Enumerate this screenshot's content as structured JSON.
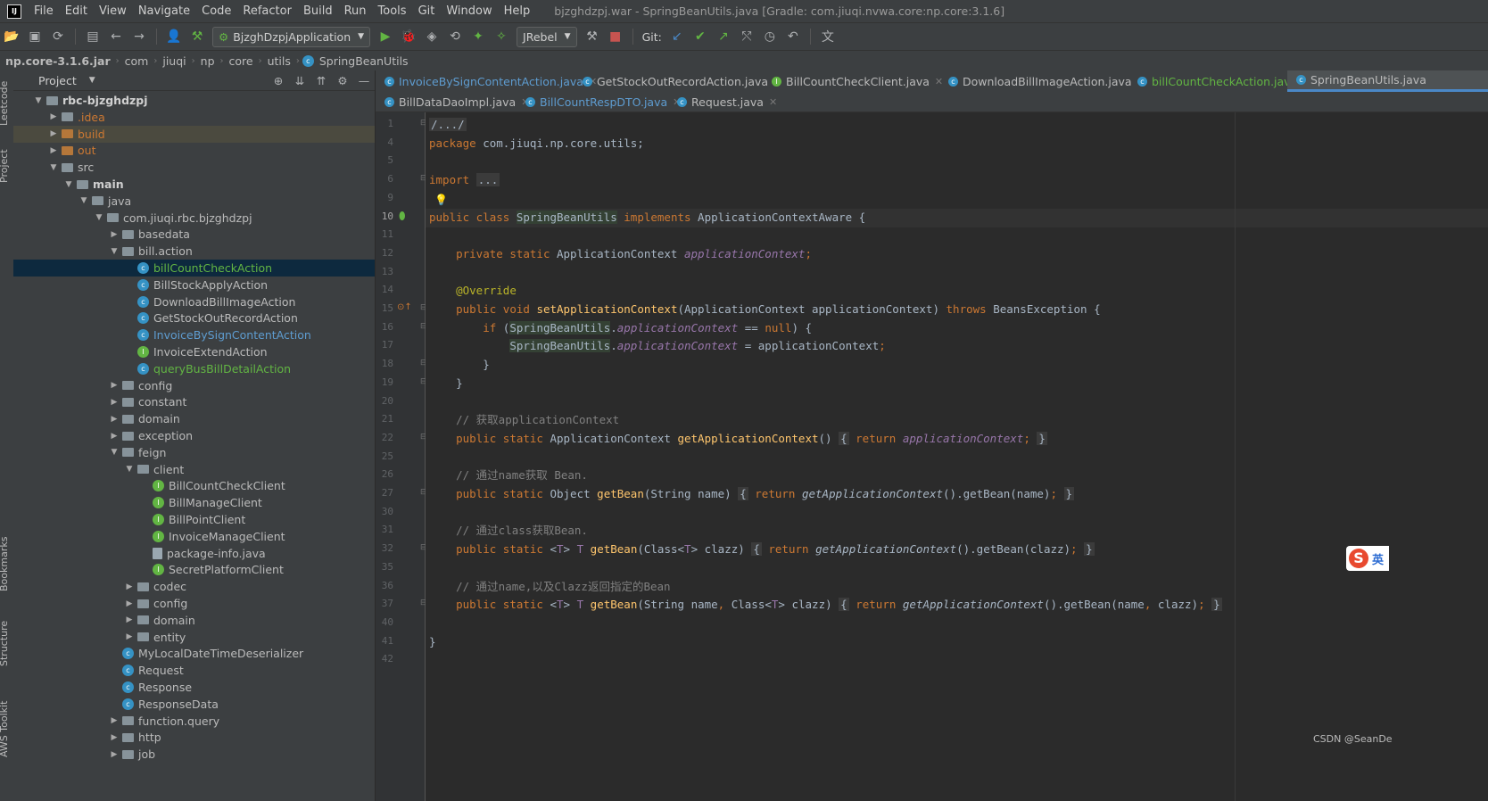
{
  "menu": {
    "logo": "IJ",
    "items": [
      "File",
      "Edit",
      "View",
      "Navigate",
      "Code",
      "Refactor",
      "Build",
      "Run",
      "Tools",
      "Git",
      "Window",
      "Help"
    ],
    "window_title": "bjzghdzpj.war - SpringBeanUtils.java [Gradle: com.jiuqi.nvwa.core:np.core:3.1.6]"
  },
  "toolbar": {
    "run_config": "BjzghDzpjApplication",
    "jrebel": "JRebel",
    "git_label": "Git:"
  },
  "navbar": {
    "crumbs": [
      "np.core-3.1.6.jar",
      "com",
      "jiuqi",
      "np",
      "core",
      "utils",
      "SpringBeanUtils"
    ]
  },
  "stripe": {
    "leetcode": "Leetcode",
    "project": "Project",
    "bookmarks": "Bookmarks",
    "structure": "Structure",
    "aws": "AWS Toolkit"
  },
  "project_panel": {
    "title": "Project",
    "tree": [
      {
        "label": "rbc-bjzghdzpj",
        "depth": 0,
        "arrow": "v",
        "icon": "module",
        "bold": true
      },
      {
        "label": ".idea",
        "depth": 1,
        "arrow": ">",
        "icon": "folder",
        "color": "#cc7832"
      },
      {
        "label": "build",
        "depth": 1,
        "arrow": ">",
        "icon": "folder-orange",
        "color": "#cc7832"
      },
      {
        "label": "out",
        "depth": 1,
        "arrow": ">",
        "icon": "folder-orange",
        "color": "#cc7832"
      },
      {
        "label": "src",
        "depth": 1,
        "arrow": "v",
        "icon": "folder"
      },
      {
        "label": "main",
        "depth": 2,
        "arrow": "v",
        "icon": "folder",
        "bold": true
      },
      {
        "label": "java",
        "depth": 3,
        "arrow": "v",
        "icon": "folder"
      },
      {
        "label": "com.jiuqi.rbc.bjzghdzpj",
        "depth": 4,
        "arrow": "v",
        "icon": "folder"
      },
      {
        "label": "basedata",
        "depth": 5,
        "arrow": ">",
        "icon": "folder"
      },
      {
        "label": "bill.action",
        "depth": 5,
        "arrow": "v",
        "icon": "folder"
      },
      {
        "label": "billCountCheckAction",
        "depth": 6,
        "arrow": "",
        "icon": "class",
        "color": "#62b543"
      },
      {
        "label": "BillStockApplyAction",
        "depth": 6,
        "arrow": "",
        "icon": "class"
      },
      {
        "label": "DownloadBillImageAction",
        "depth": 6,
        "arrow": "",
        "icon": "class"
      },
      {
        "label": "GetStockOutRecordAction",
        "depth": 6,
        "arrow": "",
        "icon": "class"
      },
      {
        "label": "InvoiceBySignContentAction",
        "depth": 6,
        "arrow": "",
        "icon": "class",
        "color": "#5e9cd0"
      },
      {
        "label": "InvoiceExtendAction",
        "depth": 6,
        "arrow": "",
        "icon": "interface"
      },
      {
        "label": "queryBusBillDetailAction",
        "depth": 6,
        "arrow": "",
        "icon": "class",
        "color": "#62b543"
      },
      {
        "label": "config",
        "depth": 5,
        "arrow": ">",
        "icon": "folder"
      },
      {
        "label": "constant",
        "depth": 5,
        "arrow": ">",
        "icon": "folder"
      },
      {
        "label": "domain",
        "depth": 5,
        "arrow": ">",
        "icon": "folder"
      },
      {
        "label": "exception",
        "depth": 5,
        "arrow": ">",
        "icon": "folder"
      },
      {
        "label": "feign",
        "depth": 5,
        "arrow": "v",
        "icon": "folder"
      },
      {
        "label": "client",
        "depth": 6,
        "arrow": "v",
        "icon": "folder"
      },
      {
        "label": "BillCountCheckClient",
        "depth": 7,
        "arrow": "",
        "icon": "interface"
      },
      {
        "label": "BillManageClient",
        "depth": 7,
        "arrow": "",
        "icon": "interface"
      },
      {
        "label": "BillPointClient",
        "depth": 7,
        "arrow": "",
        "icon": "interface"
      },
      {
        "label": "InvoiceManageClient",
        "depth": 7,
        "arrow": "",
        "icon": "interface"
      },
      {
        "label": "package-info.java",
        "depth": 7,
        "arrow": "",
        "icon": "file"
      },
      {
        "label": "SecretPlatformClient",
        "depth": 7,
        "arrow": "",
        "icon": "interface"
      },
      {
        "label": "codec",
        "depth": 6,
        "arrow": ">",
        "icon": "folder"
      },
      {
        "label": "config",
        "depth": 6,
        "arrow": ">",
        "icon": "folder"
      },
      {
        "label": "domain",
        "depth": 6,
        "arrow": ">",
        "icon": "folder"
      },
      {
        "label": "entity",
        "depth": 6,
        "arrow": ">",
        "icon": "folder"
      },
      {
        "label": "MyLocalDateTimeDeserializer",
        "depth": 5,
        "arrow": "",
        "icon": "class"
      },
      {
        "label": "Request",
        "depth": 5,
        "arrow": "",
        "icon": "class"
      },
      {
        "label": "Response",
        "depth": 5,
        "arrow": "",
        "icon": "class"
      },
      {
        "label": "ResponseData",
        "depth": 5,
        "arrow": "",
        "icon": "class"
      },
      {
        "label": "function.query",
        "depth": 5,
        "arrow": ">",
        "icon": "folder"
      },
      {
        "label": "http",
        "depth": 5,
        "arrow": ">",
        "icon": "folder"
      },
      {
        "label": "job",
        "depth": 5,
        "arrow": ">",
        "icon": "folder"
      }
    ]
  },
  "tabs_row1": [
    {
      "label": "InvoiceBySignContentAction.java",
      "icon": "class",
      "color": "#5e9cd0"
    },
    {
      "label": "GetStockOutRecordAction.java",
      "icon": "class"
    },
    {
      "label": "BillCountCheckClient.java",
      "icon": "interface"
    },
    {
      "label": "DownloadBillImageAction.java",
      "icon": "class"
    },
    {
      "label": "billCountCheckAction.java",
      "icon": "class",
      "color": "#62b543"
    },
    {
      "label": "SpringBeanUtils.java",
      "icon": "class",
      "active": true
    }
  ],
  "tabs_row2": [
    {
      "label": "BillDataDaoImpl.java",
      "icon": "class"
    },
    {
      "label": "BillCountRespDTO.java",
      "icon": "class",
      "color": "#5e9cd0"
    },
    {
      "label": "Request.java",
      "icon": "class"
    }
  ],
  "code": [
    {
      "n": "1",
      "html": "<span class='fold'>/.../</span>"
    },
    {
      "n": "4",
      "html": "<span class='kw'>package</span> com.jiuqi.np.core.utils;"
    },
    {
      "n": "5",
      "html": ""
    },
    {
      "n": "6",
      "html": "<span class='kw'>import</span> <span class='fold'>...</span>"
    },
    {
      "n": "9",
      "html": ""
    },
    {
      "n": "10",
      "html": "<span class='kw'>public class</span> <span class='clsn'>SpringBeanUtils</span> <span class='kw'>implements</span> ApplicationContextAware {"
    },
    {
      "n": "11",
      "html": ""
    },
    {
      "n": "12",
      "html": "    <span class='kw'>private static</span> ApplicationContext <span class='fld'>applicationContext</span><span class='kw'>;</span>"
    },
    {
      "n": "13",
      "html": ""
    },
    {
      "n": "14",
      "html": "    <span class='an'>@Override</span>"
    },
    {
      "n": "15",
      "html": "    <span class='kw'>public void</span> <span class='fn'>setApplicationContext</span>(ApplicationContext applicationContext) <span class='kw'>throws</span> BeansException {"
    },
    {
      "n": "16",
      "html": "        <span class='kw'>if</span> (<span class='clsn'>SpringBeanUtils</span>.<span class='fld'>applicationContext</span> == <span class='kw'>null</span>) {"
    },
    {
      "n": "17",
      "html": "            <span class='clsn'>SpringBeanUtils</span>.<span class='fld'>applicationContext</span> = applicationContext<span class='kw'>;</span>"
    },
    {
      "n": "18",
      "html": "        }"
    },
    {
      "n": "19",
      "html": "    }"
    },
    {
      "n": "20",
      "html": ""
    },
    {
      "n": "21",
      "html": "    <span class='cm'>// 获取applicationContext</span>"
    },
    {
      "n": "22",
      "html": "    <span class='kw'>public static</span> ApplicationContext <span class='fn'>getApplicationContext</span>() <span class='fold'>{</span> <span class='kw'>return</span> <span class='fld'>applicationContext</span><span class='kw'>;</span> <span class='fold'>}</span>"
    },
    {
      "n": "25",
      "html": ""
    },
    {
      "n": "26",
      "html": "    <span class='cm'>// 通过name获取 Bean.</span>"
    },
    {
      "n": "27",
      "html": "    <span class='kw'>public static</span> Object <span class='fn'>getBean</span>(String name) <span class='fold'>{</span> <span class='kw'>return</span> <i>getApplicationContext</i>().getBean(name)<span class='kw'>;</span> <span class='fold'>}</span>"
    },
    {
      "n": "30",
      "html": ""
    },
    {
      "n": "31",
      "html": "    <span class='cm'>// 通过class获取Bean.</span>"
    },
    {
      "n": "32",
      "html": "    <span class='kw'>public static</span> &lt;<span class='fld' style='font-style:normal'>T</span>&gt; <span class='fld' style='font-style:normal'>T</span> <span class='fn'>getBean</span>(Class&lt;<span class='fld' style='font-style:normal'>T</span>&gt; clazz) <span class='fold'>{</span> <span class='kw'>return</span> <i>getApplicationContext</i>().getBean(clazz)<span class='kw'>;</span> <span class='fold'>}</span>"
    },
    {
      "n": "35",
      "html": ""
    },
    {
      "n": "36",
      "html": "    <span class='cm'>// 通过name,以及Clazz返回指定的Bean</span>"
    },
    {
      "n": "37",
      "html": "    <span class='kw'>public static</span> &lt;<span class='fld' style='font-style:normal'>T</span>&gt; <span class='fld' style='font-style:normal'>T</span> <span class='fn'>getBean</span>(String name<span class='kw'>,</span> Class&lt;<span class='fld' style='font-style:normal'>T</span>&gt; clazz) <span class='fold'>{</span> <span class='kw'>return</span> <i>getApplicationContext</i>().getBean(name<span class='kw'>,</span> clazz)<span class='kw'>;</span> <span class='fold'>}</span>"
    },
    {
      "n": "40",
      "html": ""
    },
    {
      "n": "41",
      "html": "}"
    },
    {
      "n": "42",
      "html": ""
    }
  ],
  "watermark": "CSDN @SeanDe",
  "ime": {
    "glyph": "S",
    "lang": "英"
  },
  "colors": {
    "accent": "#4a88c7",
    "selection": "#0d293e",
    "bg": "#2b2b2b",
    "panel": "#3c3f41"
  }
}
